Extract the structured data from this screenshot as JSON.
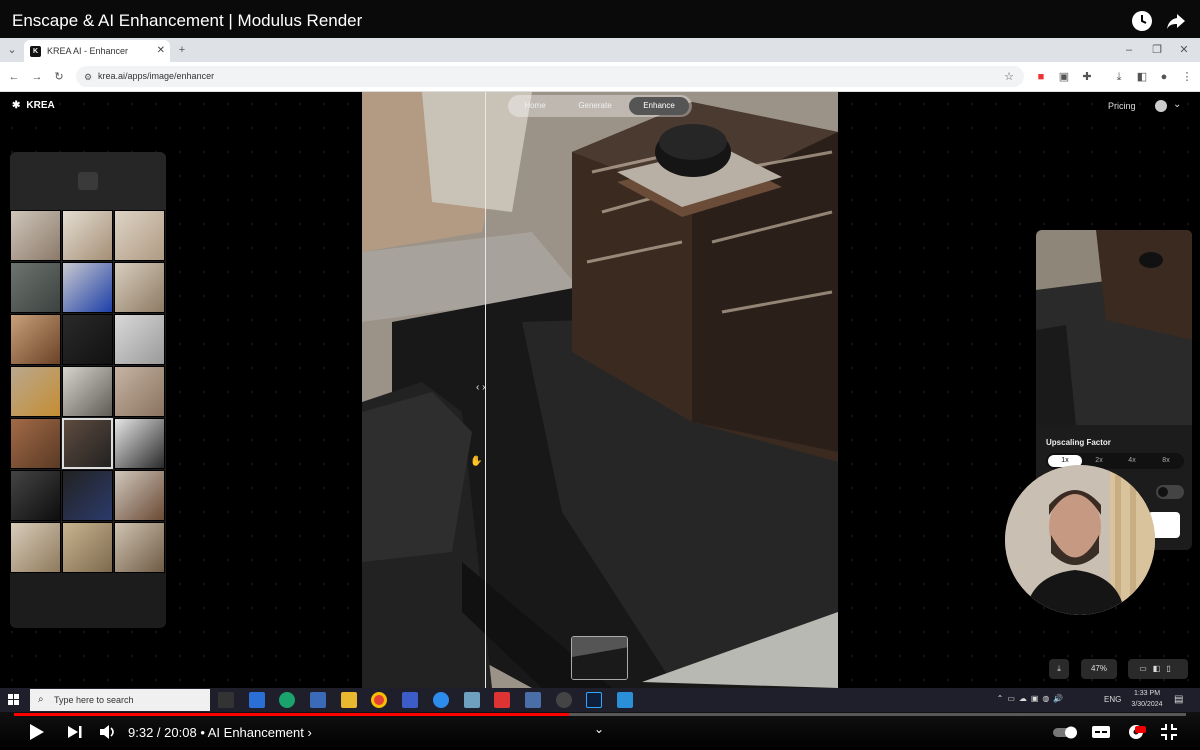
{
  "video": {
    "title": "Enscape & AI Enhancement | Modulus Render",
    "time_current": "9:32",
    "time_total": "20:08",
    "chapter": "AI Enhancement",
    "progress": 0.4735
  },
  "browser": {
    "tab_title": "KREA AI - Enhancer",
    "tab_favicon": "K",
    "url": "krea.ai/apps/image/enhancer"
  },
  "app": {
    "logo": "KREA",
    "nav": [
      "Home",
      "Generate",
      "Enhance"
    ],
    "active_nav": "Enhance",
    "pricing": "Pricing",
    "upscaling_label": "Upscaling Factor",
    "factors": [
      "1x",
      "2x",
      "4x",
      "8x"
    ],
    "active_factor": "1x",
    "zoom": "47%"
  },
  "taskbar": {
    "search_placeholder": "Type here to search",
    "lang": "ENG",
    "time": "1:33 PM",
    "date": "3/30/2024"
  },
  "colors": {
    "yt_red": "#ff0000",
    "accent": "#555555"
  }
}
